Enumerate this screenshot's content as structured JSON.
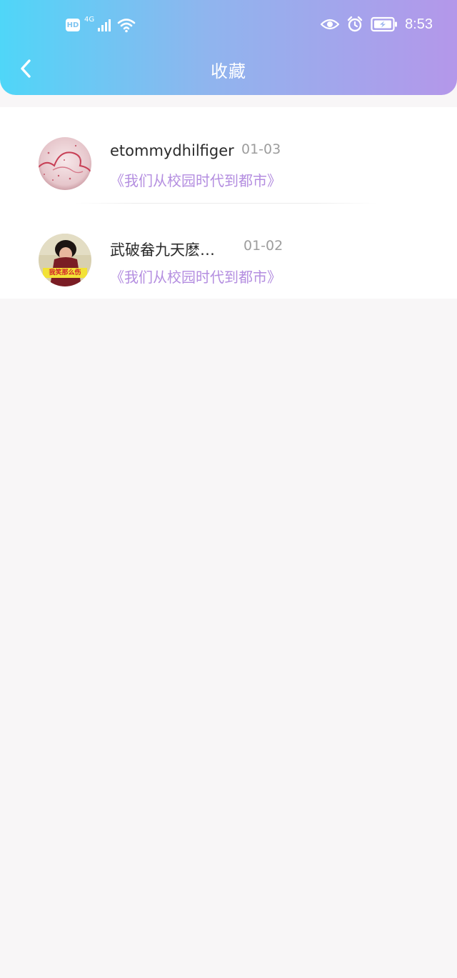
{
  "status_bar": {
    "hd_label": "HD",
    "network_label": "4G",
    "time": "8:53",
    "icons": [
      "hd-icon",
      "signal-icon",
      "wifi-icon",
      "eye-icon",
      "alarm-icon",
      "battery-icon"
    ]
  },
  "header": {
    "title": "收藏",
    "back_icon": "chevron-left-icon"
  },
  "favorites": [
    {
      "user": "etommydhilfiger",
      "date": "01-03",
      "title": "《我们从校园时代到都市》"
    },
    {
      "user": "武破畚九天麽…",
      "date": "01-02",
      "title": "《我们从校园时代到都市》",
      "avatar_caption": "我笑那么伤"
    }
  ],
  "colors": {
    "header_gradient_start": "#4fd6f8",
    "header_gradient_end": "#b497ea",
    "accent": "#b48ee0",
    "background": "#f8f6f7"
  }
}
